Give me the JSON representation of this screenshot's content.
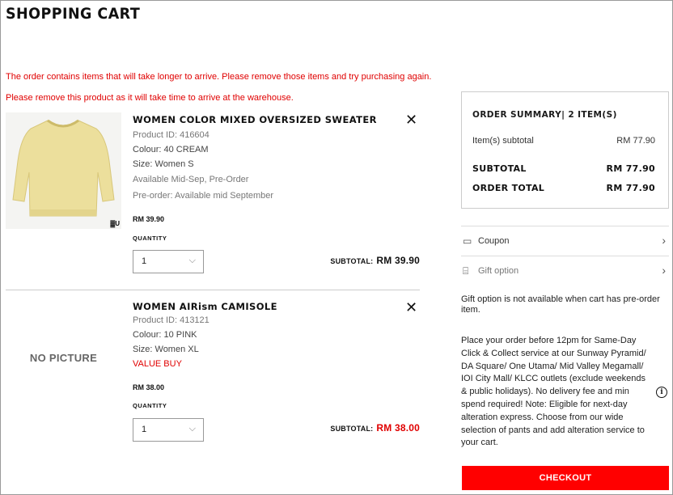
{
  "header": {
    "title": "SHOPPING CART"
  },
  "errors": {
    "order_message": "The order contains items that will take longer to arrive. Please remove those items and try purchasing again.",
    "product_message": "Please remove this product as it will take time to arrive at the warehouse."
  },
  "items": [
    {
      "name": "WOMEN COLOR MIXED OVERSIZED SWEATER",
      "product_id": "Product ID: 416604",
      "colour": "Colour: 40 CREAM",
      "size": "Size: Women S",
      "availability": "Available Mid-Sep, Pre-Order",
      "preorder": "Pre-order: Available mid September",
      "price": "RM 39.90",
      "quantity_label": "QUANTITY",
      "quantity": "1",
      "subtotal_label": "SUBTOTAL:",
      "subtotal": "RM 39.90",
      "brand_mark": "▓U"
    },
    {
      "name": "WOMEN AIRism CAMISOLE",
      "no_picture": "NO PICTURE",
      "product_id": "Product ID: 413121",
      "colour": "Colour: 10 PINK",
      "size": "Size: Women XL",
      "badge": "VALUE BUY",
      "price": "RM 38.00",
      "quantity_label": "QUANTITY",
      "quantity": "1",
      "subtotal_label": "SUBTOTAL:",
      "subtotal": "RM 38.00"
    }
  ],
  "summary": {
    "title": "ORDER SUMMARY| 2 ITEM(S)",
    "items_subtotal_label": "Item(s) subtotal",
    "items_subtotal": "RM 77.90",
    "subtotal_label": "SUBTOTAL",
    "subtotal": "RM 77.90",
    "total_label": "ORDER TOTAL",
    "total": "RM 77.90"
  },
  "options": {
    "coupon": "Coupon",
    "gift": "Gift option",
    "gift_note": "Gift option is not available when cart has pre-order item.",
    "service_note": "Place your order before 12pm for Same-Day Click & Collect service at our Sunway Pyramid/ DA Square/ One Utama/ Mid Valley Megamall/ IOI City Mall/ KLCC outlets (exclude weekends & public holidays). No delivery fee and min spend required! Note: Eligible for next-day alteration express. Choose from our wide selection of pants and add alteration service to your cart."
  },
  "checkout": {
    "label": "CHECKOUT"
  },
  "colors": {
    "accent_red": "#ff0000",
    "error_red": "#e00000"
  }
}
